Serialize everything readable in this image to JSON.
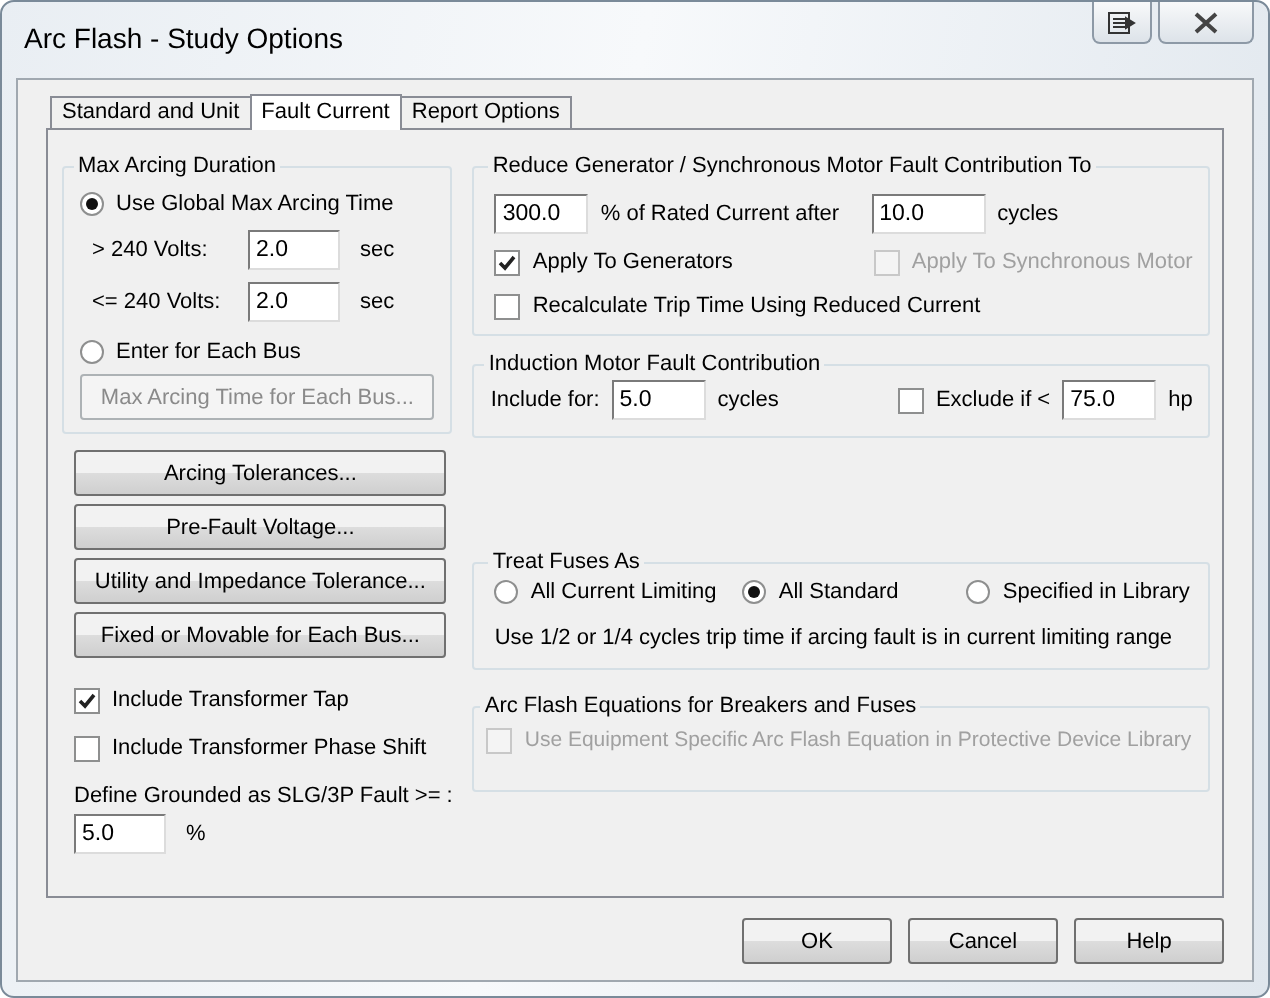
{
  "window": {
    "title": "Arc Flash - Study Options"
  },
  "tabs": [
    {
      "label": "Standard and Unit",
      "selected": false
    },
    {
      "label": "Fault Current",
      "selected": true
    },
    {
      "label": "Report Options",
      "selected": false
    }
  ],
  "max_arcing": {
    "title": "Max Arcing Duration",
    "global_option": {
      "label": "Use Global Max Arcing Time",
      "selected": true
    },
    "fields": [
      {
        "label": "> 240 Volts:",
        "value": "2.0",
        "unit": "sec"
      },
      {
        "label": "<= 240 Volts:",
        "value": "2.0",
        "unit": "sec"
      }
    ],
    "each_bus_option": {
      "label": "Enter for Each Bus",
      "selected": false
    },
    "each_bus_button": {
      "label": "Max Arcing Time for Each Bus...",
      "disabled": true
    }
  },
  "left_buttons": [
    "Arcing Tolerances...",
    "Pre-Fault Voltage...",
    "Utility and Impedance Tolerance...",
    "Fixed or Movable for Each Bus..."
  ],
  "left_checks": [
    {
      "label": "Include Transformer Tap",
      "checked": true
    },
    {
      "label": "Include Transformer Phase Shift",
      "checked": false
    }
  ],
  "grounded": {
    "label": "Define Grounded as SLG/3P Fault >= :",
    "value": "5.0",
    "unit": "%"
  },
  "reduce_generator": {
    "title": "Reduce Generator / Synchronous Motor Fault Contribution To",
    "percent_value": "300.0",
    "percent_label": "% of Rated Current after",
    "cycles_value": "10.0",
    "cycles_unit": "cycles",
    "apply_checks": [
      {
        "label": "Apply To Generators",
        "checked": true,
        "disabled": false
      },
      {
        "label": "Apply To Synchronous Motor",
        "checked": false,
        "disabled": true
      }
    ],
    "recalculate": {
      "label": "Recalculate Trip Time Using Reduced Current",
      "checked": false
    }
  },
  "induction_motor": {
    "title": "Induction Motor Fault Contribution",
    "include_label": "Include for:",
    "include_value": "5.0",
    "include_unit": "cycles",
    "exclude": {
      "label": "Exclude if <",
      "checked": false
    },
    "exclude_value": "75.0",
    "exclude_unit": "hp"
  },
  "treat_fuses": {
    "title": "Treat Fuses As",
    "options": [
      {
        "label": "All Current Limiting",
        "selected": false
      },
      {
        "label": "All Standard",
        "selected": true
      },
      {
        "label": "Specified in Library",
        "selected": false
      }
    ],
    "note": "Use 1/2 or 1/4 cycles trip time if arcing fault is in current limiting range"
  },
  "equations": {
    "title": "Arc Flash Equations for Breakers and Fuses",
    "check": {
      "label": "Use Equipment Specific Arc Flash Equation in Protective Device Library",
      "checked": false,
      "disabled": true
    }
  },
  "buttons": [
    "OK",
    "Cancel",
    "Help"
  ]
}
